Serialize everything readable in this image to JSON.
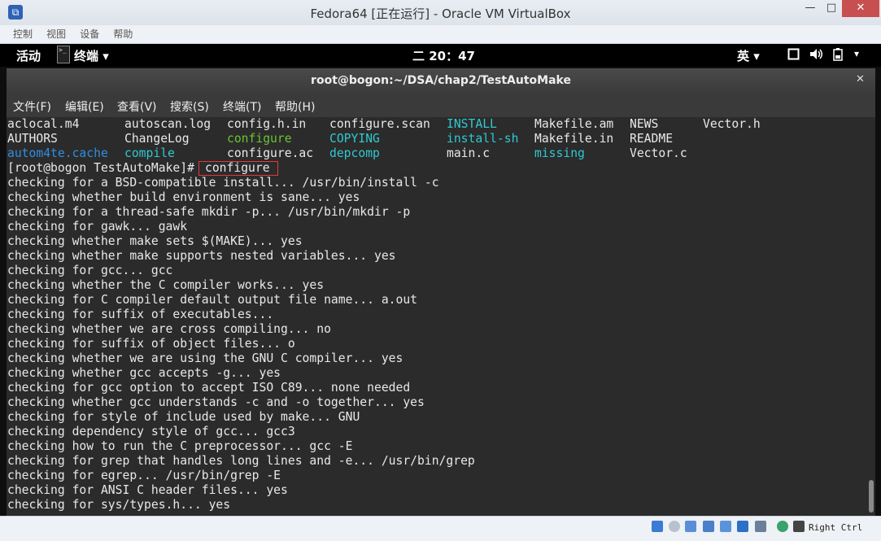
{
  "host_window": {
    "title": "Fedora64 [正在运行] - Oracle VM VirtualBox",
    "menu": [
      "控制",
      "视图",
      "设备",
      "帮助"
    ],
    "buttons": {
      "minimize": "—",
      "maximize": "□",
      "close": "✕"
    },
    "host_key": "Right Ctrl"
  },
  "gnome_bar": {
    "activities": "活动",
    "app_menu": "终端 ▾",
    "clock": "二 20：47",
    "ime": "英 ▾",
    "dropdown": "▾"
  },
  "terminal": {
    "title": "root@bogon:~/DSA/chap2/TestAutoMake",
    "close": "✕",
    "menu": [
      "文件(F)",
      "编辑(E)",
      "查看(V)",
      "搜索(S)",
      "终端(T)",
      "帮助(H)"
    ],
    "ls_rows": [
      [
        {
          "text": "aclocal.m4",
          "color": "white"
        },
        {
          "text": "autoscan.log",
          "color": "white"
        },
        {
          "text": "config.h.in",
          "color": "white"
        },
        {
          "text": "configure.scan",
          "color": "white"
        },
        {
          "text": "INSTALL",
          "color": "cyan"
        },
        {
          "text": "Makefile.am",
          "color": "white"
        },
        {
          "text": "NEWS",
          "color": "white"
        },
        {
          "text": "Vector.h",
          "color": "white"
        }
      ],
      [
        {
          "text": "AUTHORS",
          "color": "white"
        },
        {
          "text": "ChangeLog",
          "color": "white"
        },
        {
          "text": "configure",
          "color": "green"
        },
        {
          "text": "COPYING",
          "color": "cyan"
        },
        {
          "text": "install-sh",
          "color": "cyan"
        },
        {
          "text": "Makefile.in",
          "color": "white"
        },
        {
          "text": "README",
          "color": "white"
        }
      ],
      [
        {
          "text": "autom4te.cache",
          "color": "blue"
        },
        {
          "text": "compile",
          "color": "cyan"
        },
        {
          "text": "configure.ac",
          "color": "white"
        },
        {
          "text": "depcomp",
          "color": "cyan"
        },
        {
          "text": "main.c",
          "color": "white"
        },
        {
          "text": "missing",
          "color": "cyan"
        },
        {
          "text": "Vector.c",
          "color": "white"
        }
      ]
    ],
    "prompt": "[root@bogon TestAutoMake]# ",
    "command": "configure",
    "output": [
      "checking for a BSD-compatible install... /usr/bin/install -c",
      "checking whether build environment is sane... yes",
      "checking for a thread-safe mkdir -p... /usr/bin/mkdir -p",
      "checking for gawk... gawk",
      "checking whether make sets $(MAKE)... yes",
      "checking whether make supports nested variables... yes",
      "checking for gcc... gcc",
      "checking whether the C compiler works... yes",
      "checking for C compiler default output file name... a.out",
      "checking for suffix of executables...",
      "checking whether we are cross compiling... no",
      "checking for suffix of object files... o",
      "checking whether we are using the GNU C compiler... yes",
      "checking whether gcc accepts -g... yes",
      "checking for gcc option to accept ISO C89... none needed",
      "checking whether gcc understands -c and -o together... yes",
      "checking for style of include used by make... GNU",
      "checking dependency style of gcc... gcc3",
      "checking how to run the C preprocessor... gcc -E",
      "checking for grep that handles long lines and -e... /usr/bin/grep",
      "checking for egrep... /usr/bin/grep -E",
      "checking for ANSI C header files... yes",
      "checking for sys/types.h... yes"
    ]
  },
  "colors": {
    "white": "#e8e8e8",
    "cyan": "#2fc9d0",
    "blue": "#2f8fe0",
    "green": "#6bc232",
    "highlight": "#e23a3a"
  }
}
